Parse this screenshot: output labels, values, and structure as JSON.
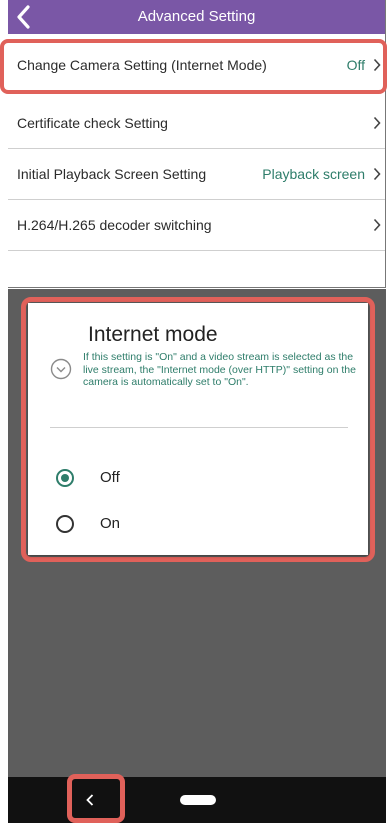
{
  "header": {
    "title": "Advanced Setting",
    "back_icon": "chevron-left-icon"
  },
  "settings": [
    {
      "label": "Change Camera Setting (Internet Mode)",
      "value": "Off",
      "highlighted": true
    },
    {
      "label": "Certificate check Setting",
      "value": ""
    },
    {
      "label": "Initial Playback Screen Setting",
      "value": "Playback screen"
    },
    {
      "label": "H.264/H.265 decoder switching",
      "value": ""
    }
  ],
  "dialog": {
    "title": "Internet mode",
    "info_icon": "info-circle-icon",
    "description": "If this setting is \"On\" and a video stream is selected as the live stream, the \"Internet mode (over HTTP)\" setting on the camera is automatically set to \"On\".",
    "options": [
      {
        "label": "Off",
        "selected": true
      },
      {
        "label": "On",
        "selected": false
      }
    ]
  },
  "navbar": {
    "back_icon": "nav-back-icon",
    "home_icon": "nav-home-pill-icon"
  },
  "colors": {
    "header_bg": "#7a57a6",
    "accent": "#2e7d6a",
    "highlight": "#e0615a",
    "overlay": "#5d5d5d"
  }
}
